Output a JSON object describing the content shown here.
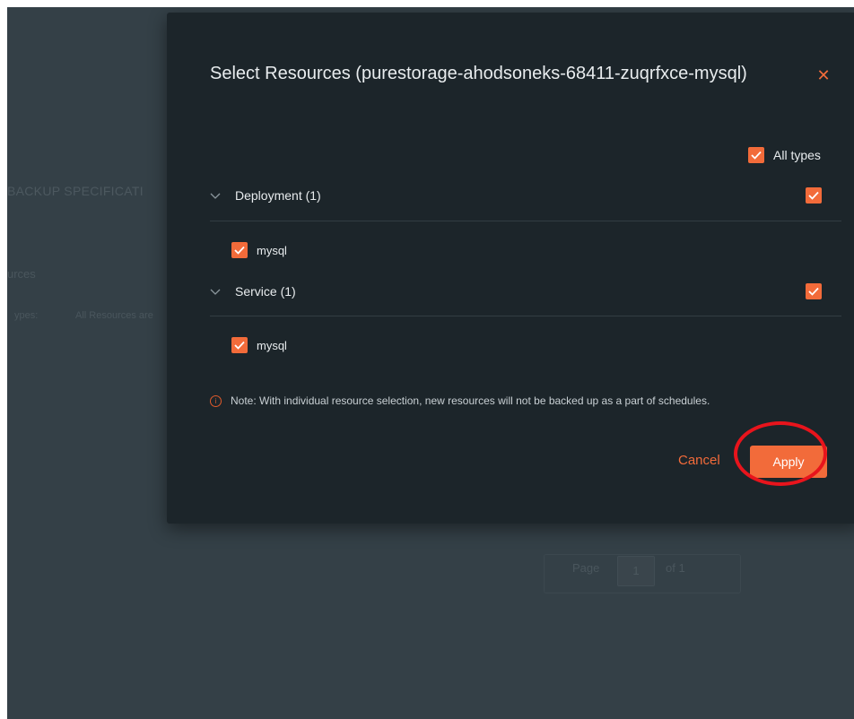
{
  "background": {
    "heading": "BACKUP SPECIFICATI",
    "resources_label": "urces",
    "types_label": "ypes:",
    "types_value": "All Resources are",
    "pager": {
      "page_label": "Page",
      "page_value": "1",
      "of_label": "of 1"
    }
  },
  "modal": {
    "title": "Select Resources (purestorage-ahodsoneks-68411-zuqrfxce-mysql)",
    "close_icon": "close-icon",
    "all_types": {
      "label": "All types",
      "checked": true
    },
    "groups": [
      {
        "label": "Deployment (1)",
        "checked": true,
        "items": [
          {
            "label": "mysql",
            "checked": true
          }
        ]
      },
      {
        "label": "Service (1)",
        "checked": true,
        "items": [
          {
            "label": "mysql",
            "checked": true
          }
        ]
      }
    ],
    "note": "Note: With individual resource selection, new resources will not be backed up as a part of schedules.",
    "cancel_label": "Cancel",
    "apply_label": "Apply"
  },
  "colors": {
    "accent": "#f26b3a",
    "modal_bg": "#1c252a",
    "backdrop": "#344047",
    "highlight": "#e8141c"
  }
}
